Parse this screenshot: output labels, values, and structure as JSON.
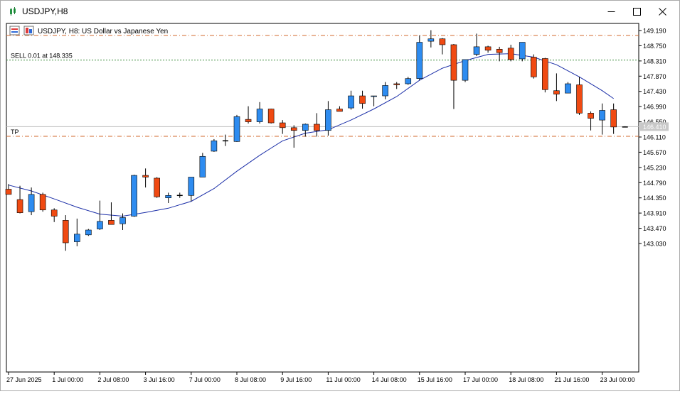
{
  "window": {
    "title": "USDJPY,H8",
    "minimize_icon": "minimize-icon",
    "maximize_icon": "maximize-icon",
    "close_icon": "close-icon"
  },
  "chart_header": {
    "text": "USDJPY, H8:  US Dollar vs Japanese Yen"
  },
  "levels": {
    "sell_label": "SELL 0.01 at 148.335",
    "tp_label": "TP",
    "current_price_label": "146.410",
    "top_line_price": 149.05,
    "sell_price": 148.335,
    "tp_price": 146.13,
    "current_price": 146.41
  },
  "colors": {
    "bull": "#2e8cf0",
    "bear": "#f04a12",
    "ma": "#1c2fa8",
    "level_orange": "#d26a2e",
    "level_green": "#3c8c3c",
    "current_line": "#c0c0c0"
  },
  "chart_data": {
    "type": "candlestick",
    "symbol": "USDJPY",
    "timeframe": "H8",
    "y_ticks": [
      "149.190",
      "148.750",
      "148.310",
      "147.870",
      "147.430",
      "146.990",
      "146.550",
      "146.110",
      "145.670",
      "145.230",
      "144.790",
      "144.350",
      "143.910",
      "143.470",
      "143.030"
    ],
    "x_ticks": [
      {
        "label": "27 Jun 2025",
        "i": 0
      },
      {
        "label": "1 Jul 00:00",
        "i": 4
      },
      {
        "label": "2 Jul 08:00",
        "i": 8
      },
      {
        "label": "3 Jul 16:00",
        "i": 12
      },
      {
        "label": "7 Jul 00:00",
        "i": 16
      },
      {
        "label": "8 Jul 08:00",
        "i": 20
      },
      {
        "label": "9 Jul 16:00",
        "i": 24
      },
      {
        "label": "11 Jul 00:00",
        "i": 28
      },
      {
        "label": "14 Jul 08:00",
        "i": 32
      },
      {
        "label": "15 Jul 16:00",
        "i": 36
      },
      {
        "label": "17 Jul 00:00",
        "i": 40
      },
      {
        "label": "18 Jul 08:00",
        "i": 44
      },
      {
        "label": "21 Jul 16:00",
        "i": 48
      },
      {
        "label": "23 Jul 00:00",
        "i": 52
      }
    ],
    "candles": [
      [
        144.6,
        144.75,
        144.45,
        144.45
      ],
      [
        144.3,
        144.7,
        143.9,
        143.92
      ],
      [
        143.95,
        144.65,
        143.85,
        144.45
      ],
      [
        144.45,
        144.5,
        143.95,
        144.0
      ],
      [
        144.0,
        144.05,
        143.65,
        143.82
      ],
      [
        143.7,
        143.85,
        142.82,
        143.05
      ],
      [
        143.08,
        143.75,
        142.95,
        143.3
      ],
      [
        143.28,
        143.45,
        143.25,
        143.42
      ],
      [
        143.45,
        144.27,
        143.42,
        143.67
      ],
      [
        143.7,
        144.22,
        143.62,
        143.58
      ],
      [
        143.6,
        143.9,
        143.42,
        143.78
      ],
      [
        143.82,
        145.02,
        143.8,
        145.0
      ],
      [
        145.0,
        145.2,
        144.65,
        144.95
      ],
      [
        144.92,
        144.95,
        144.35,
        144.38
      ],
      [
        144.35,
        144.5,
        144.2,
        144.42
      ],
      [
        144.42,
        144.5,
        144.35,
        144.42
      ],
      [
        144.42,
        144.95,
        144.25,
        144.95
      ],
      [
        144.95,
        145.65,
        144.95,
        145.55
      ],
      [
        145.7,
        146.05,
        145.68,
        146.0
      ],
      [
        146.0,
        146.18,
        145.85,
        146.0
      ],
      [
        145.98,
        146.75,
        145.97,
        146.7
      ],
      [
        146.62,
        147.0,
        146.5,
        146.55
      ],
      [
        146.55,
        147.12,
        146.5,
        146.92
      ],
      [
        146.92,
        146.93,
        146.5,
        146.52
      ],
      [
        146.52,
        146.6,
        146.2,
        146.38
      ],
      [
        146.38,
        146.45,
        145.8,
        146.3
      ],
      [
        146.3,
        146.5,
        146.12,
        146.48
      ],
      [
        146.48,
        146.8,
        146.12,
        146.3
      ],
      [
        146.3,
        147.15,
        146.15,
        146.9
      ],
      [
        146.92,
        147.0,
        146.9,
        146.85
      ],
      [
        146.95,
        147.45,
        146.9,
        147.3
      ],
      [
        147.3,
        147.45,
        146.93,
        147.08
      ],
      [
        147.28,
        147.3,
        147.0,
        147.3
      ],
      [
        147.3,
        147.7,
        147.2,
        147.6
      ],
      [
        147.65,
        147.7,
        147.5,
        147.62
      ],
      [
        147.65,
        147.85,
        147.62,
        147.8
      ],
      [
        147.8,
        149.05,
        147.75,
        148.85
      ],
      [
        148.88,
        149.2,
        148.7,
        148.95
      ],
      [
        148.95,
        148.97,
        148.5,
        148.78
      ],
      [
        148.78,
        148.8,
        146.92,
        147.75
      ],
      [
        147.75,
        148.3,
        147.7,
        148.35
      ],
      [
        148.5,
        149.1,
        148.45,
        148.72
      ],
      [
        148.72,
        148.75,
        148.55,
        148.62
      ],
      [
        148.65,
        148.72,
        148.3,
        148.55
      ],
      [
        148.68,
        148.78,
        148.3,
        148.35
      ],
      [
        148.37,
        148.85,
        148.3,
        148.85
      ],
      [
        148.42,
        148.5,
        147.8,
        147.85
      ],
      [
        148.38,
        148.4,
        147.4,
        147.48
      ],
      [
        147.45,
        147.95,
        147.15,
        147.35
      ],
      [
        147.38,
        147.7,
        147.4,
        147.65
      ],
      [
        147.62,
        147.85,
        146.75,
        146.8
      ],
      [
        146.8,
        146.85,
        146.3,
        146.65
      ],
      [
        146.6,
        147.08,
        146.18,
        146.88
      ],
      [
        146.9,
        147.08,
        146.2,
        146.4
      ],
      [
        146.4,
        146.42,
        146.4,
        146.41
      ]
    ],
    "ma": [
      [
        0,
        144.72
      ],
      [
        2,
        144.55
      ],
      [
        4,
        144.32
      ],
      [
        6,
        144.08
      ],
      [
        8,
        143.88
      ],
      [
        10,
        143.82
      ],
      [
        12,
        143.93
      ],
      [
        14,
        144.05
      ],
      [
        16,
        144.25
      ],
      [
        18,
        144.62
      ],
      [
        20,
        145.12
      ],
      [
        22,
        145.58
      ],
      [
        24,
        146.0
      ],
      [
        26,
        146.22
      ],
      [
        28,
        146.32
      ],
      [
        30,
        146.6
      ],
      [
        32,
        146.92
      ],
      [
        34,
        147.28
      ],
      [
        36,
        147.75
      ],
      [
        38,
        148.1
      ],
      [
        40,
        148.32
      ],
      [
        42,
        148.5
      ],
      [
        44,
        148.52
      ],
      [
        46,
        148.42
      ],
      [
        48,
        148.2
      ],
      [
        50,
        147.85
      ],
      [
        52,
        147.45
      ],
      [
        53,
        147.22
      ]
    ]
  }
}
